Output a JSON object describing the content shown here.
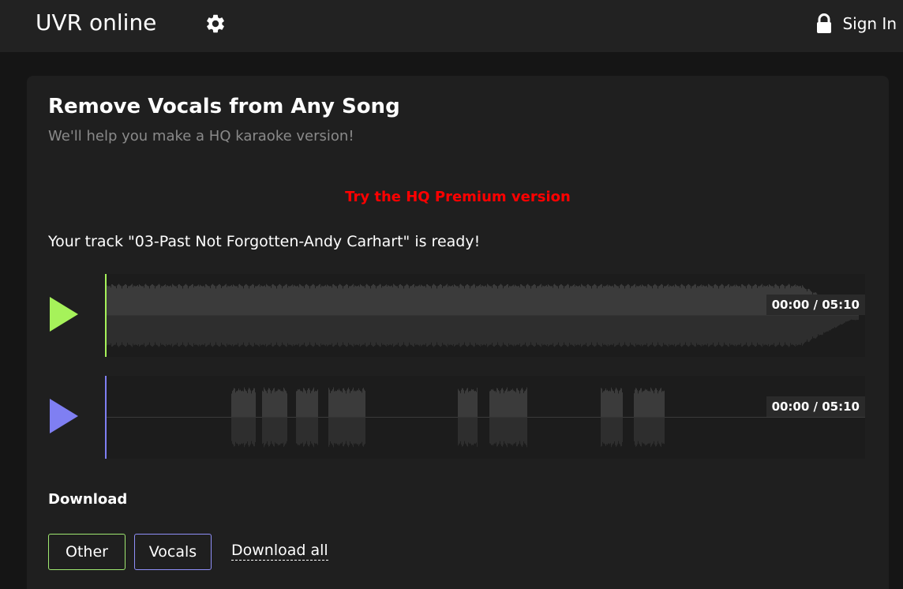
{
  "header": {
    "brand": "UVR online",
    "settings_icon": "gear-icon",
    "signin_icon": "lock-icon",
    "signin_label": "Sign In"
  },
  "main": {
    "title": "Remove Vocals from Any Song",
    "subtitle": "We'll help you make a HQ karaoke version!",
    "premium_link": "Try the HQ Premium version",
    "ready_text": "Your track \"03-Past Not Forgotten-Andy Carhart\" is ready!",
    "tracks": [
      {
        "name": "Other",
        "play_icon": "play-icon",
        "color": "#a6f25a",
        "current": "00:00",
        "duration": "05:10"
      },
      {
        "name": "Vocals",
        "play_icon": "play-icon",
        "color": "#7f7ff2",
        "current": "00:00",
        "duration": "05:10"
      }
    ],
    "download": {
      "heading": "Download",
      "other_label": "Other",
      "vocals_label": "Vocals",
      "all_label": "Download all"
    }
  },
  "colors": {
    "page_bg": "#151515",
    "header_bg": "#222222",
    "card_bg": "#1f1f1f",
    "premium": "#ff0000",
    "other_accent": "#a6f25a",
    "vocals_accent": "#7f7ff2"
  }
}
